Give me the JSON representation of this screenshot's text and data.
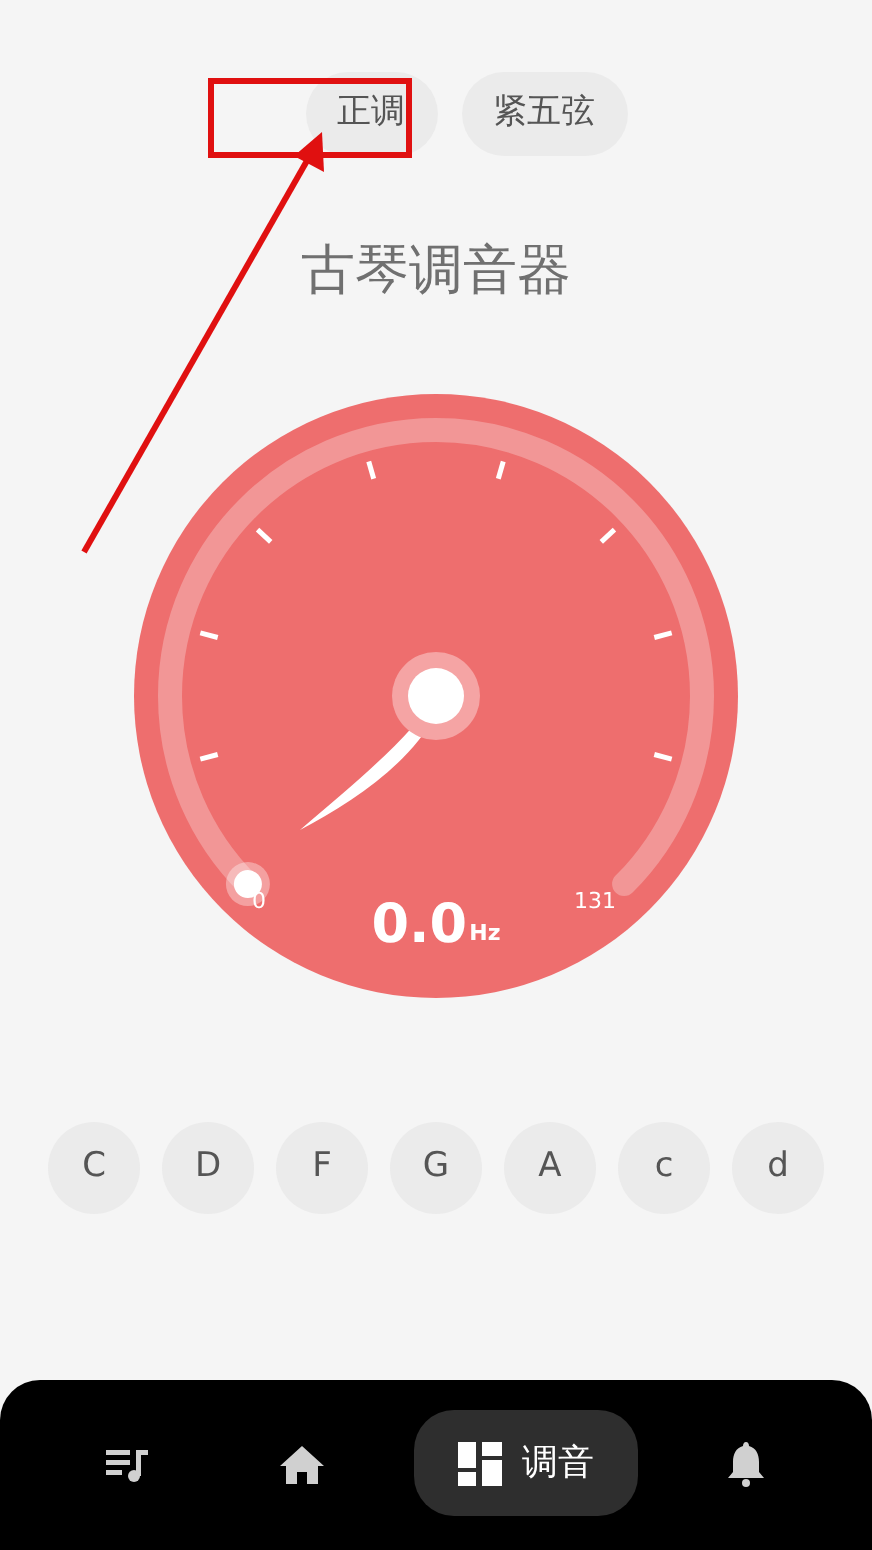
{
  "modes": [
    {
      "label": "正调"
    },
    {
      "label": "紧五弦"
    }
  ],
  "title": "古琴调音器",
  "gauge": {
    "min_label": "0",
    "max_label": "131",
    "reading": "0.0",
    "unit": "Hz"
  },
  "strings": [
    {
      "label": "C"
    },
    {
      "label": "D"
    },
    {
      "label": "F"
    },
    {
      "label": "G"
    },
    {
      "label": "A"
    },
    {
      "label": "c"
    },
    {
      "label": "d"
    }
  ],
  "nav": [
    {
      "selected": false
    },
    {
      "selected": false
    },
    {
      "selected": true,
      "label": "调音"
    },
    {
      "selected": false
    }
  ]
}
